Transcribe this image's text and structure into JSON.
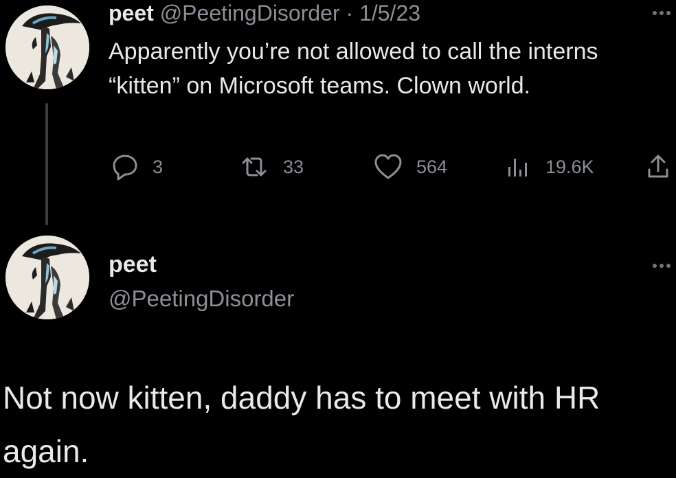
{
  "tweet1": {
    "display_name": "peet",
    "handle": "@PeetingDisorder",
    "separator": "·",
    "date": "1/5/23",
    "text": "Apparently you’re not allowed to call the interns “kitten” on Microsoft teams. Clown world.",
    "replies": "3",
    "retweets": "33",
    "likes": "564",
    "views": "19.6K",
    "avatar_icon": "profile-avatar",
    "more_icon": "more-options-icon"
  },
  "tweet2": {
    "display_name": "peet",
    "handle": "@PeetingDisorder",
    "text": "Not now kitten, daddy has to meet with HR again.",
    "avatar_icon": "profile-avatar",
    "more_icon": "more-options-icon"
  },
  "colors": {
    "background": "#000000",
    "text": "#e7e9ea",
    "muted": "#8b9096",
    "thread_line": "#3a3d41"
  }
}
